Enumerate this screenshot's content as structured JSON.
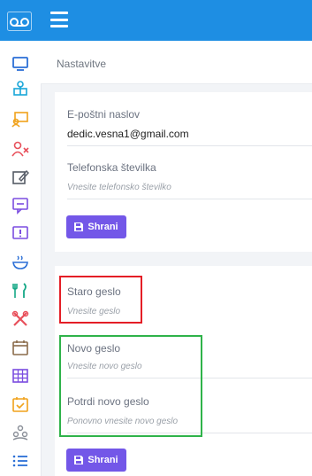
{
  "header": {
    "menu_icon": "hamburger-icon",
    "logo_icon": "voicemail-logo-icon"
  },
  "sidebar": {
    "icons": [
      "monitor-icon",
      "person-tree-icon",
      "teacher-icon",
      "user-remove-icon",
      "edit-icon",
      "chat-icon",
      "alert-message-icon",
      "food-bowl-icon",
      "kitchen-icon",
      "tools-icon",
      "calendar-icon",
      "grid-icon",
      "calendar-check-icon",
      "people-group-icon",
      "list-icon"
    ],
    "colors": [
      "#2b6fd6",
      "#19a6d8",
      "#f0a21b",
      "#e8505b",
      "#555b66",
      "#7b4de0",
      "#7b4de0",
      "#2b6fd6",
      "#15a886",
      "#e8505b",
      "#8a6b4a",
      "#7b4de0",
      "#f0a21b",
      "#8a8f98",
      "#2b6fd6"
    ]
  },
  "breadcrumb": {
    "title": "Nastavitve"
  },
  "contact_form": {
    "email_label": "E-poštni naslov",
    "email_value": "dedic.vesna1@gmail.com",
    "phone_label": "Telefonska številka",
    "phone_placeholder": "Vnesite telefonsko številko",
    "save_label": "Shrani"
  },
  "password_form": {
    "old_label": "Staro geslo",
    "old_placeholder": "Vnesite geslo",
    "new_label": "Novo geslo",
    "new_placeholder": "Vnesite novo geslo",
    "confirm_label": "Potrdi novo geslo",
    "confirm_placeholder": "Ponovno vnesite novo geslo",
    "save_label": "Shrani"
  },
  "highlight_colors": {
    "red": "#e41e26",
    "green": "#2fb34a",
    "button": "#7357e8",
    "topbar": "#1e8ee3"
  }
}
